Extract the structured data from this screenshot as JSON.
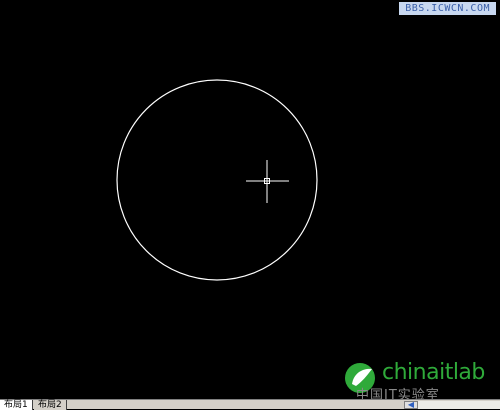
{
  "watermark": {
    "text": "BBS.ICWCN.COM"
  },
  "tabs": [
    {
      "label": "布局1"
    },
    {
      "label": "布局2"
    }
  ],
  "logo": {
    "brand": "chinaitlab",
    "subtitle": "中国IT实验室"
  },
  "colors": {
    "background": "#000000",
    "drawing_stroke": "#ffffff",
    "tabbar": "#d4d0c8",
    "logo_green": "#2faa3a"
  },
  "icons": {
    "crosshair": "crosshair-cursor-icon",
    "scroll_left": "arrow-left-icon"
  }
}
